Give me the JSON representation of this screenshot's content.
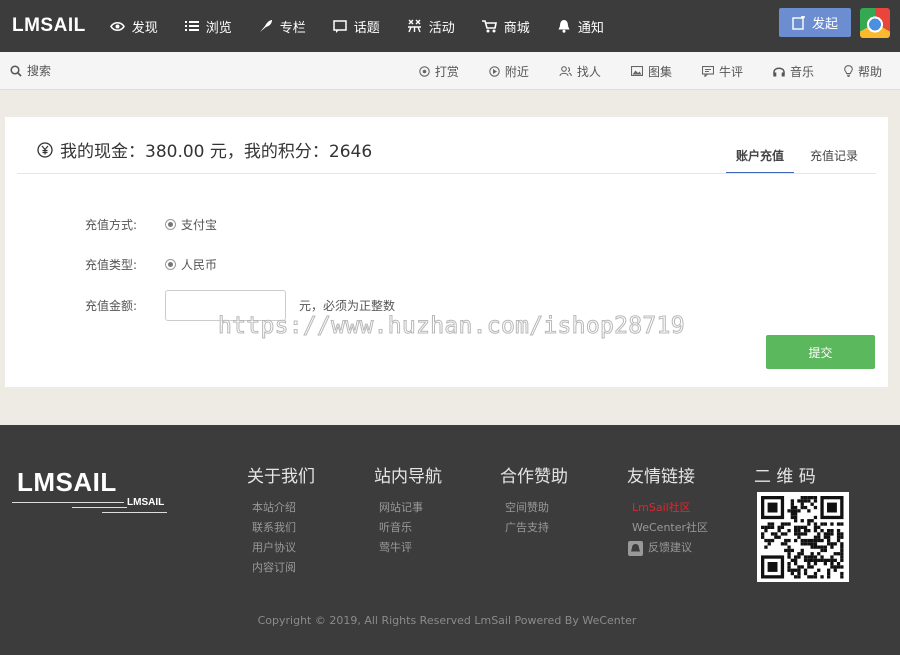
{
  "topnav": {
    "logo": "LMSAIL",
    "items": [
      {
        "label": "发现",
        "icon": "eye-icon"
      },
      {
        "label": "浏览",
        "icon": "list-icon"
      },
      {
        "label": "专栏",
        "icon": "feather-icon"
      },
      {
        "label": "话题",
        "icon": "topic-icon"
      },
      {
        "label": "活动",
        "icon": "activity-icon"
      },
      {
        "label": "商城",
        "icon": "cart-icon"
      },
      {
        "label": "通知",
        "icon": "bell-icon"
      }
    ],
    "publish_label": "发起"
  },
  "subnav": {
    "search_label": "搜索",
    "items": [
      {
        "label": "打赏",
        "icon": "reward-icon"
      },
      {
        "label": "附近",
        "icon": "nearby-icon"
      },
      {
        "label": "找人",
        "icon": "people-icon"
      },
      {
        "label": "图集",
        "icon": "image-icon"
      },
      {
        "label": "牛评",
        "icon": "comment-icon"
      },
      {
        "label": "音乐",
        "icon": "headphones-icon"
      },
      {
        "label": "帮助",
        "icon": "lightbulb-icon"
      }
    ]
  },
  "recharge": {
    "title": "我的现金：380.00 元，我的积分：2646",
    "tabs": [
      "账户充值",
      "充值记录"
    ],
    "method_label": "充值方式:",
    "method_value": "支付宝",
    "type_label": "充值类型:",
    "type_value": "人民币",
    "amount_label": "充值金额:",
    "amount_value": "",
    "amount_hint": "元，必须为正整数",
    "submit_label": "提交"
  },
  "watermark": "https://www.huzhan.com/ishop28719",
  "footer": {
    "logo": "LMSAIL",
    "logo_small": "LMSAIL",
    "columns": [
      {
        "title": "关于我们",
        "links": [
          "本站介绍",
          "联系我们",
          "用户协议",
          "内容订阅"
        ]
      },
      {
        "title": "站内导航",
        "links": [
          "网站记事",
          "听音乐",
          "莺牛评"
        ]
      },
      {
        "title": "合作赞助",
        "links": [
          "空间赞助",
          "广告支持"
        ]
      },
      {
        "title": "友情链接",
        "links": [
          "LmSail社区",
          "WeCenter社区",
          "反馈建议"
        ]
      },
      {
        "title": "二 维 码"
      }
    ],
    "copyright": "Copyright © 2019, All Rights Reserved LmSail Powered By WeCenter"
  },
  "colors": {
    "nav_bg": "#3c3c3c",
    "page_bg": "#eeebe4",
    "publish_button": "#6c8dd0",
    "submit_button": "#5cb85c",
    "tab_underline": "#3e66b8",
    "link_red": "#e3252c"
  }
}
